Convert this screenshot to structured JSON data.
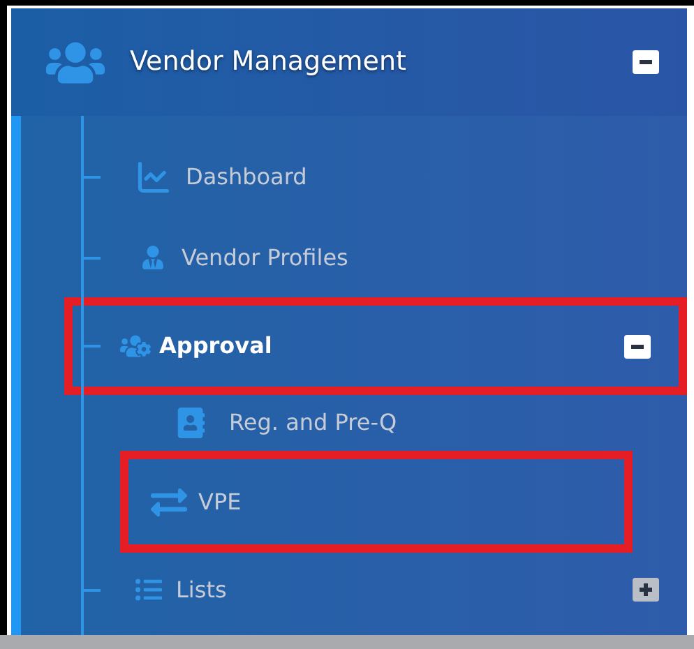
{
  "menu": {
    "title": "Vendor Management",
    "expanded": true,
    "items": [
      {
        "label": "Dashboard",
        "selected": false,
        "highlighted": false
      },
      {
        "label": "Vendor Profiles",
        "selected": false,
        "highlighted": false
      },
      {
        "label": "Approval",
        "selected": true,
        "highlighted": true,
        "expanded": true,
        "children": [
          {
            "label": "Reg. and Pre-Q",
            "selected": false,
            "highlighted": false
          },
          {
            "label": "VPE",
            "selected": false,
            "highlighted": true
          }
        ]
      },
      {
        "label": "Lists",
        "selected": false,
        "highlighted": false,
        "expanded": false
      }
    ]
  }
}
